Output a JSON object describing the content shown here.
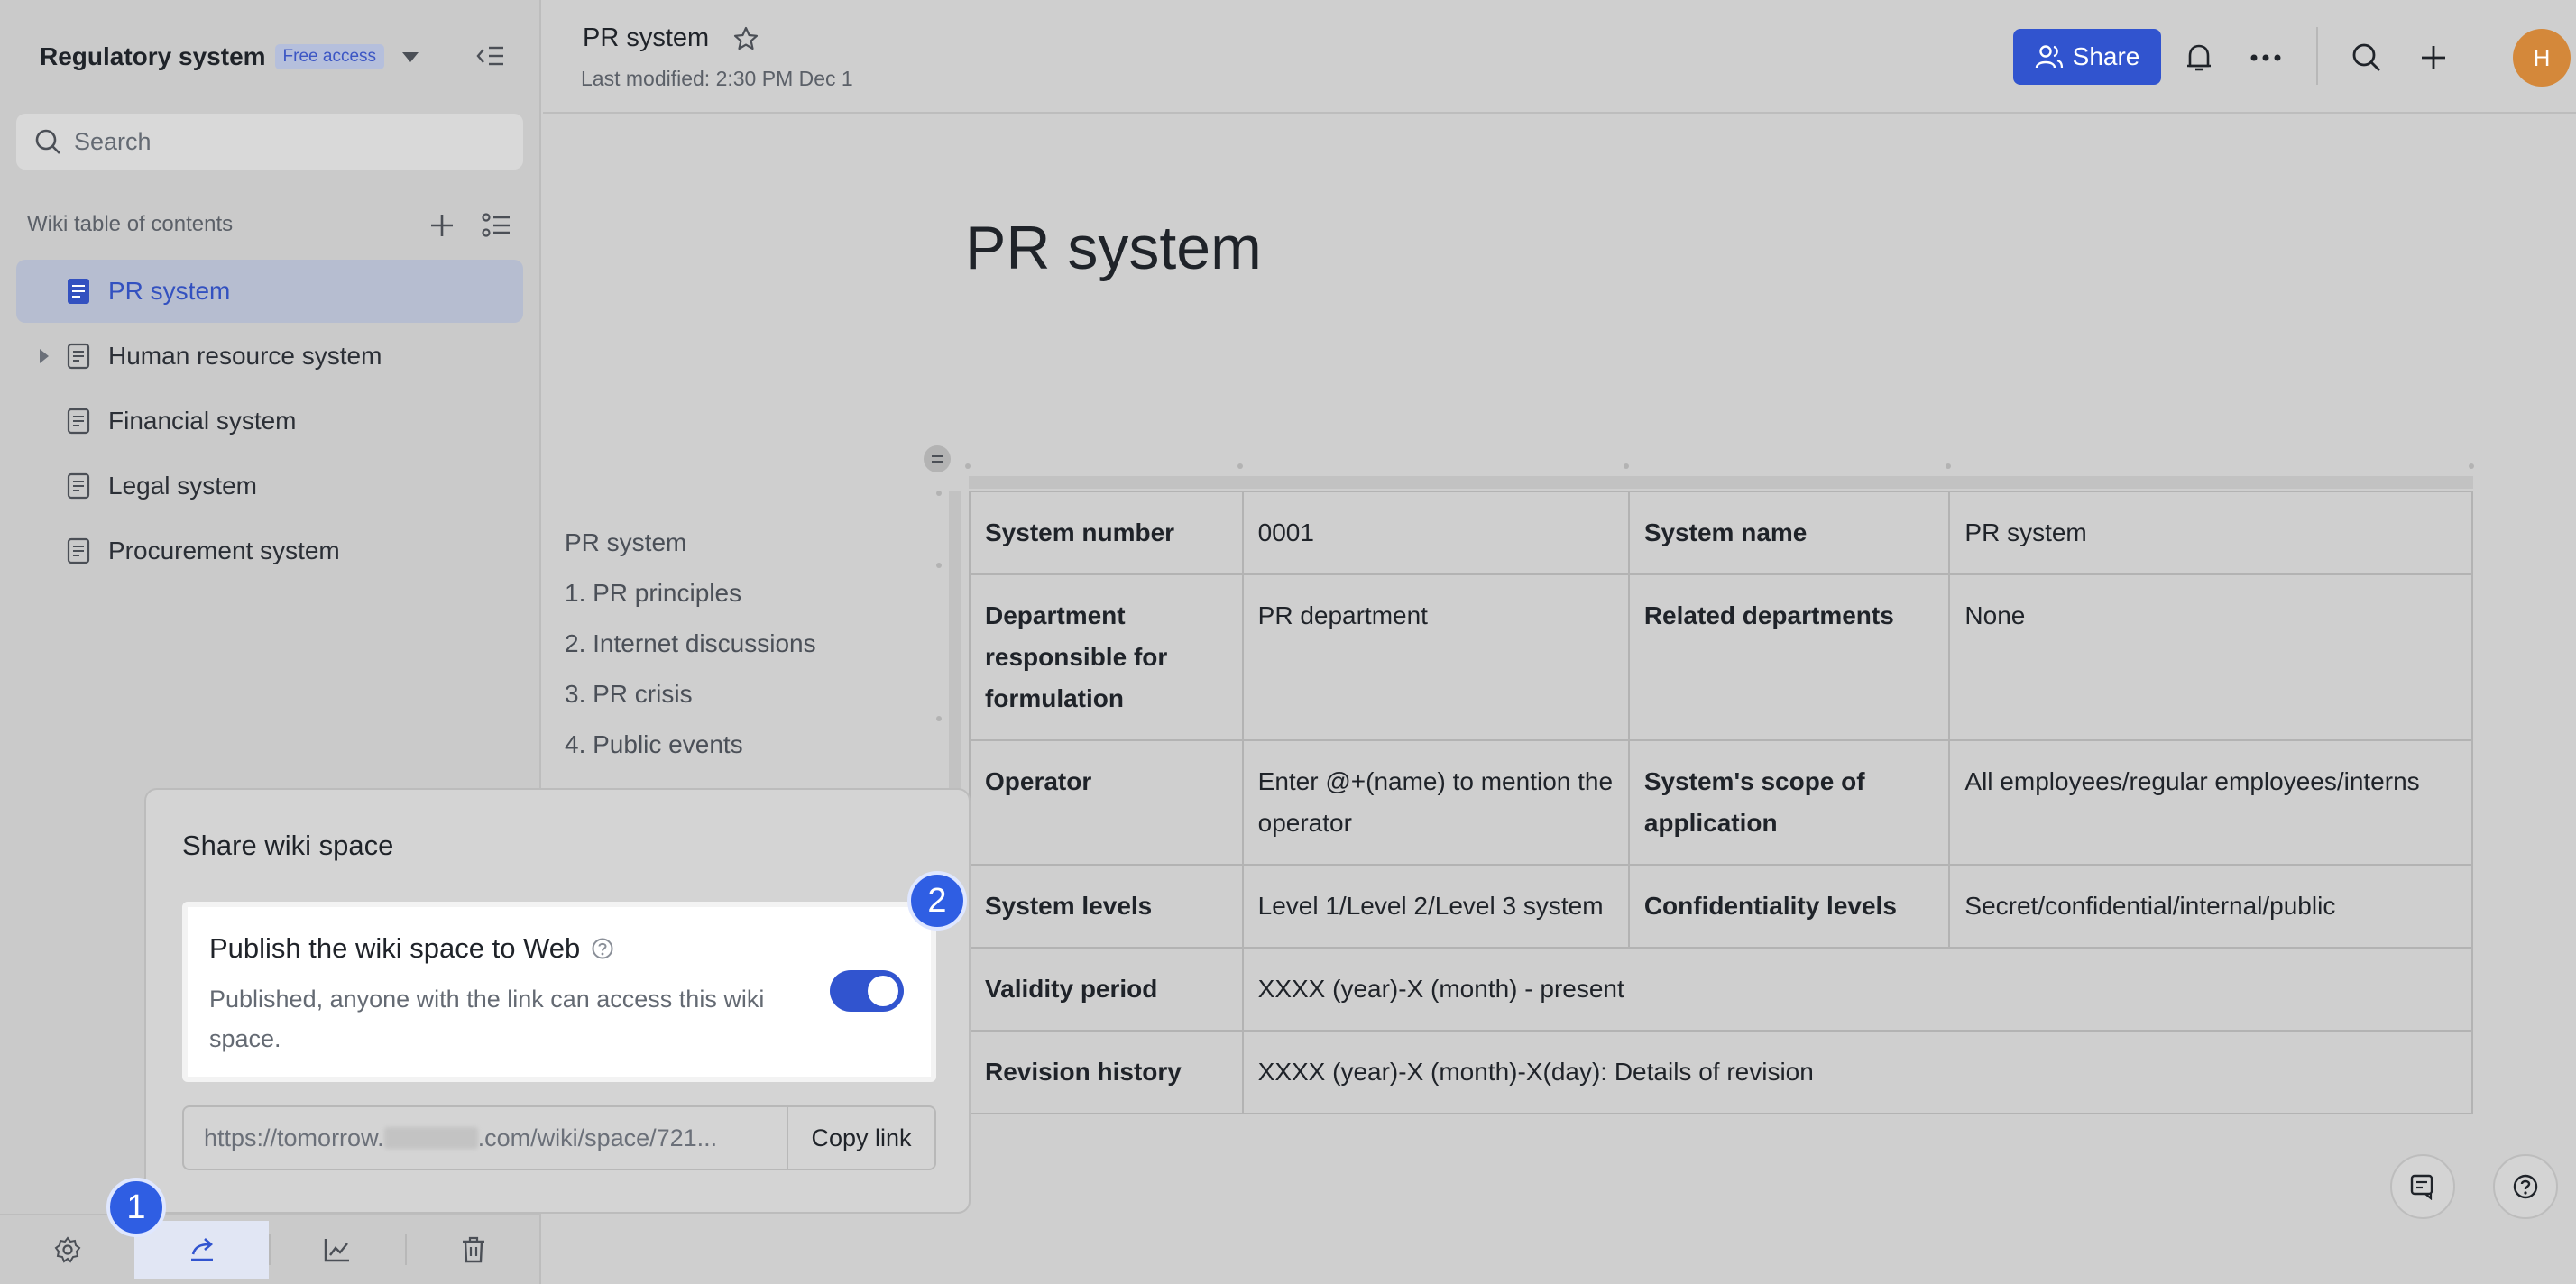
{
  "sidebar": {
    "space_title": "Regulatory system",
    "badge": "Free access",
    "search_placeholder": "Search",
    "toc_title": "Wiki table of contents",
    "items": [
      {
        "label": "PR system",
        "active": true,
        "expandable": false
      },
      {
        "label": "Human resource system",
        "active": false,
        "expandable": true
      },
      {
        "label": "Financial system",
        "active": false,
        "expandable": false
      },
      {
        "label": "Legal system",
        "active": false,
        "expandable": false
      },
      {
        "label": "Procurement system",
        "active": false,
        "expandable": false
      }
    ],
    "bottom_buttons": [
      "settings-icon",
      "share-icon",
      "chart-icon",
      "trash-icon"
    ]
  },
  "header": {
    "title": "PR system",
    "modified": "Last modified: 2:30 PM Dec 1",
    "share_label": "Share",
    "avatar_initial": "H",
    "accent": "#3154cf"
  },
  "document": {
    "title": "PR system",
    "outline": [
      "PR system",
      "1. PR principles",
      "2. Internet discussions",
      "3. PR crisis",
      "4. Public events"
    ],
    "table": {
      "system_number_k": "System number",
      "system_number_v": "0001",
      "system_name_k": "System name",
      "system_name_v": "PR system",
      "dept_k": "Department responsible for formulation",
      "dept_v": "PR department",
      "related_k": "Related departments",
      "related_v": "None",
      "operator_k": "Operator",
      "operator_v": "Enter @+(name) to mention the operator",
      "scope_k": "System's scope of application",
      "scope_v": "All employees/regular employees/interns",
      "levels_k": "System levels",
      "levels_v": "Level 1/Level 2/Level 3 system",
      "conf_k": "Confidentiality levels",
      "conf_v": "Secret/confidential/internal/public",
      "validity_k": "Validity period",
      "validity_v": "XXXX (year)-X (month) - present",
      "revision_k": "Revision history",
      "revision_v": "XXXX (year)-X (month)-X(day): Details of revision"
    }
  },
  "share_panel": {
    "title": "Share wiki space",
    "publish_title": "Publish the wiki space to Web",
    "publish_desc": "Published, anyone with the link can access this wiki space.",
    "toggle_on": true,
    "link_prefix": "https://tomorrow.",
    "link_suffix": ".com/wiki/space/721...",
    "copy_label": "Copy link"
  },
  "callouts": {
    "one": "1",
    "two": "2"
  }
}
